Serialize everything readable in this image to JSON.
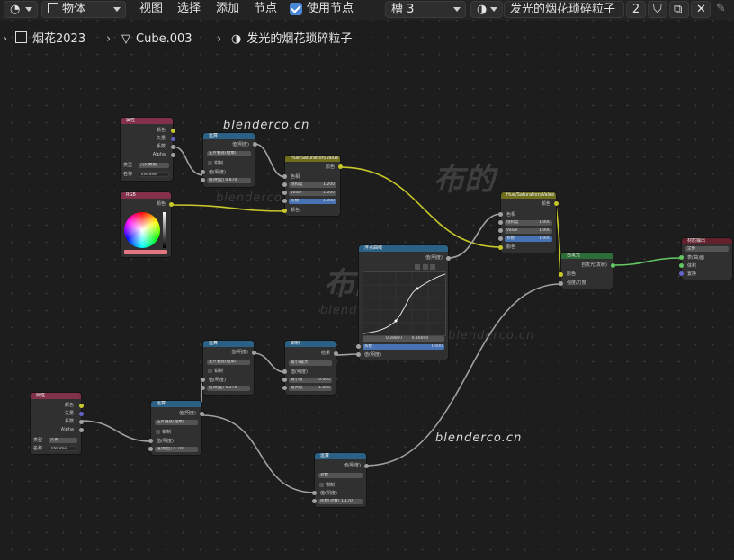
{
  "header": {
    "mode_label": "物体",
    "menus": [
      "视图",
      "选择",
      "添加",
      "节点"
    ],
    "use_nodes_label": "使用节点",
    "slot_label": "槽 3",
    "material_name": "发光的烟花琐碎粒子",
    "user_count": "2"
  },
  "breadcrumb": {
    "scene": "烟花2023",
    "object": "Cube.003",
    "material": "发光的烟花琐碎粒子"
  },
  "watermark": {
    "site": "blenderco.cn",
    "brand": "布的"
  },
  "nodes": {
    "attr1": {
      "title": "属性",
      "outputs": [
        "颜色",
        "矢量",
        "系数",
        "Alpha"
      ],
      "type_label": "类型",
      "type_value": "几何数据",
      "name_label": "名称",
      "name_value": "lifetime"
    },
    "math1": {
      "title": "运算",
      "out": "值(明度)",
      "op": "正片叠底(相乘)",
      "clamp": "钳制",
      "in_label": "值(明度)",
      "in_value": "0.870"
    },
    "hsv1": {
      "title": "Hue/Saturation/Value",
      "out": "颜色",
      "hue": "色相",
      "sat": "饱和度",
      "sat_value": "1.200",
      "val": "Value",
      "val_value": "1.000",
      "fac": "系数",
      "fac_value": "1.000",
      "col": "颜色"
    },
    "rgb": {
      "title": "RGB",
      "out": "颜色"
    },
    "hsv2": {
      "title": "Hue/Saturation/Value",
      "out": "颜色",
      "hue": "色相",
      "sat": "饱和度",
      "sat_value": "1.000",
      "val": "Value",
      "val_value": "1.000",
      "fac": "系数",
      "fac_value": "1.000",
      "col": "颜色"
    },
    "emission": {
      "title": "自发光",
      "out": "自发光(发射)",
      "color": "颜色",
      "strength": "强度/力度"
    },
    "output": {
      "title": "材质输出",
      "target": "全部",
      "surface": "表(曲)面",
      "volume": "体积",
      "disp": "置换"
    },
    "curve": {
      "title": "浮点曲线",
      "out": "值(明度)",
      "pos_x": "0.28897",
      "pos_y": "0.16000",
      "fac": "系数",
      "fac_value": "1.000",
      "val": "值(明度)"
    },
    "math2": {
      "title": "运算",
      "out": "值(明度)",
      "op": "正片叠底(相乘)",
      "clamp": "钳制",
      "in_label": "值(明度)",
      "in_value": "0.270"
    },
    "clampn": {
      "title": "钳制",
      "out": "结果",
      "mode": "最小/最大",
      "val": "值(明度)",
      "min_label": "最小值",
      "min_value": "0.000",
      "max_label": "最大值",
      "max_value": "1.000"
    },
    "attr2": {
      "title": "属性",
      "outputs": [
        "颜色",
        "矢量",
        "系数",
        "Alpha"
      ],
      "type_label": "类型",
      "type_value": "实例",
      "name_label": "名称",
      "name_value": "lifetime"
    },
    "math3": {
      "title": "运算",
      "out": "值(明度)",
      "op": "正片叠底(相乘)",
      "clamp": "钳制",
      "in_label": "值(明度)",
      "in_value": "0.100"
    },
    "math4": {
      "title": "运算",
      "out": "值(明度)",
      "op": "对数",
      "clamp": "钳制",
      "in_label": "值(明度)",
      "base_label": "底数(对数)",
      "base_value": "1.170"
    }
  },
  "colors": {
    "wire_yellow": "#c7c729",
    "wire_gray": "#a1a1a1",
    "wire_green": "#63c763",
    "accent": "#4772b3"
  }
}
